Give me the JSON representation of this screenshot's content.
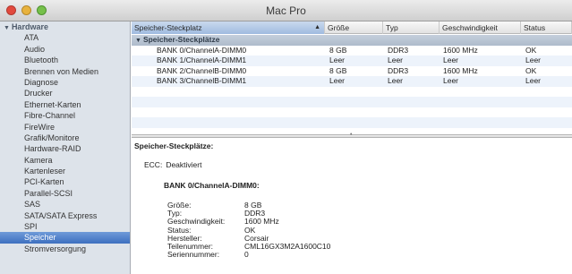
{
  "window": {
    "title": "Mac Pro"
  },
  "sidebar": {
    "group_label": "Hardware",
    "items": [
      "ATA",
      "Audio",
      "Bluetooth",
      "Brennen von Medien",
      "Diagnose",
      "Drucker",
      "Ethernet-Karten",
      "Fibre-Channel",
      "FireWire",
      "Grafik/Monitore",
      "Hardware-RAID",
      "Kamera",
      "Kartenleser",
      "PCI-Karten",
      "Parallel-SCSI",
      "SAS",
      "SATA/SATA Express",
      "SPI",
      "Speicher",
      "Stromversorgung"
    ],
    "selected": "Speicher"
  },
  "table": {
    "columns": [
      "Speicher-Steckplatz",
      "Größe",
      "Typ",
      "Geschwindigkeit",
      "Status"
    ],
    "sorted_column": "Speicher-Steckplatz",
    "group_row": "Speicher-Steckplätze",
    "rows": [
      [
        "BANK 0/ChannelA-DIMM0",
        "8 GB",
        "DDR3",
        "1600 MHz",
        "OK"
      ],
      [
        "BANK 1/ChannelA-DIMM1",
        "Leer",
        "Leer",
        "Leer",
        "Leer"
      ],
      [
        "BANK 2/ChannelB-DIMM0",
        "8 GB",
        "DDR3",
        "1600 MHz",
        "OK"
      ],
      [
        "BANK 3/ChannelB-DIMM1",
        "Leer",
        "Leer",
        "Leer",
        "Leer"
      ]
    ]
  },
  "detail": {
    "heading": "Speicher-Steckplätze:",
    "ecc_label": "ECC:",
    "ecc_value": "Deaktiviert",
    "bank_title": "BANK 0/ChannelA-DIMM0:",
    "fields": [
      {
        "label": "Größe:",
        "value": "8 GB"
      },
      {
        "label": "Typ:",
        "value": "DDR3"
      },
      {
        "label": "Geschwindigkeit:",
        "value": "1600 MHz"
      },
      {
        "label": "Status:",
        "value": "OK"
      },
      {
        "label": "Hersteller:",
        "value": "Corsair"
      },
      {
        "label": "Teilenummer:",
        "value": "CML16GX3M2A1600C10"
      },
      {
        "label": "Seriennummer:",
        "value": "0"
      }
    ]
  },
  "colors": {
    "selection": "#3d6fbf",
    "sidebar_bg": "#dde3ea",
    "group_row_bg": "#aebbcb"
  }
}
